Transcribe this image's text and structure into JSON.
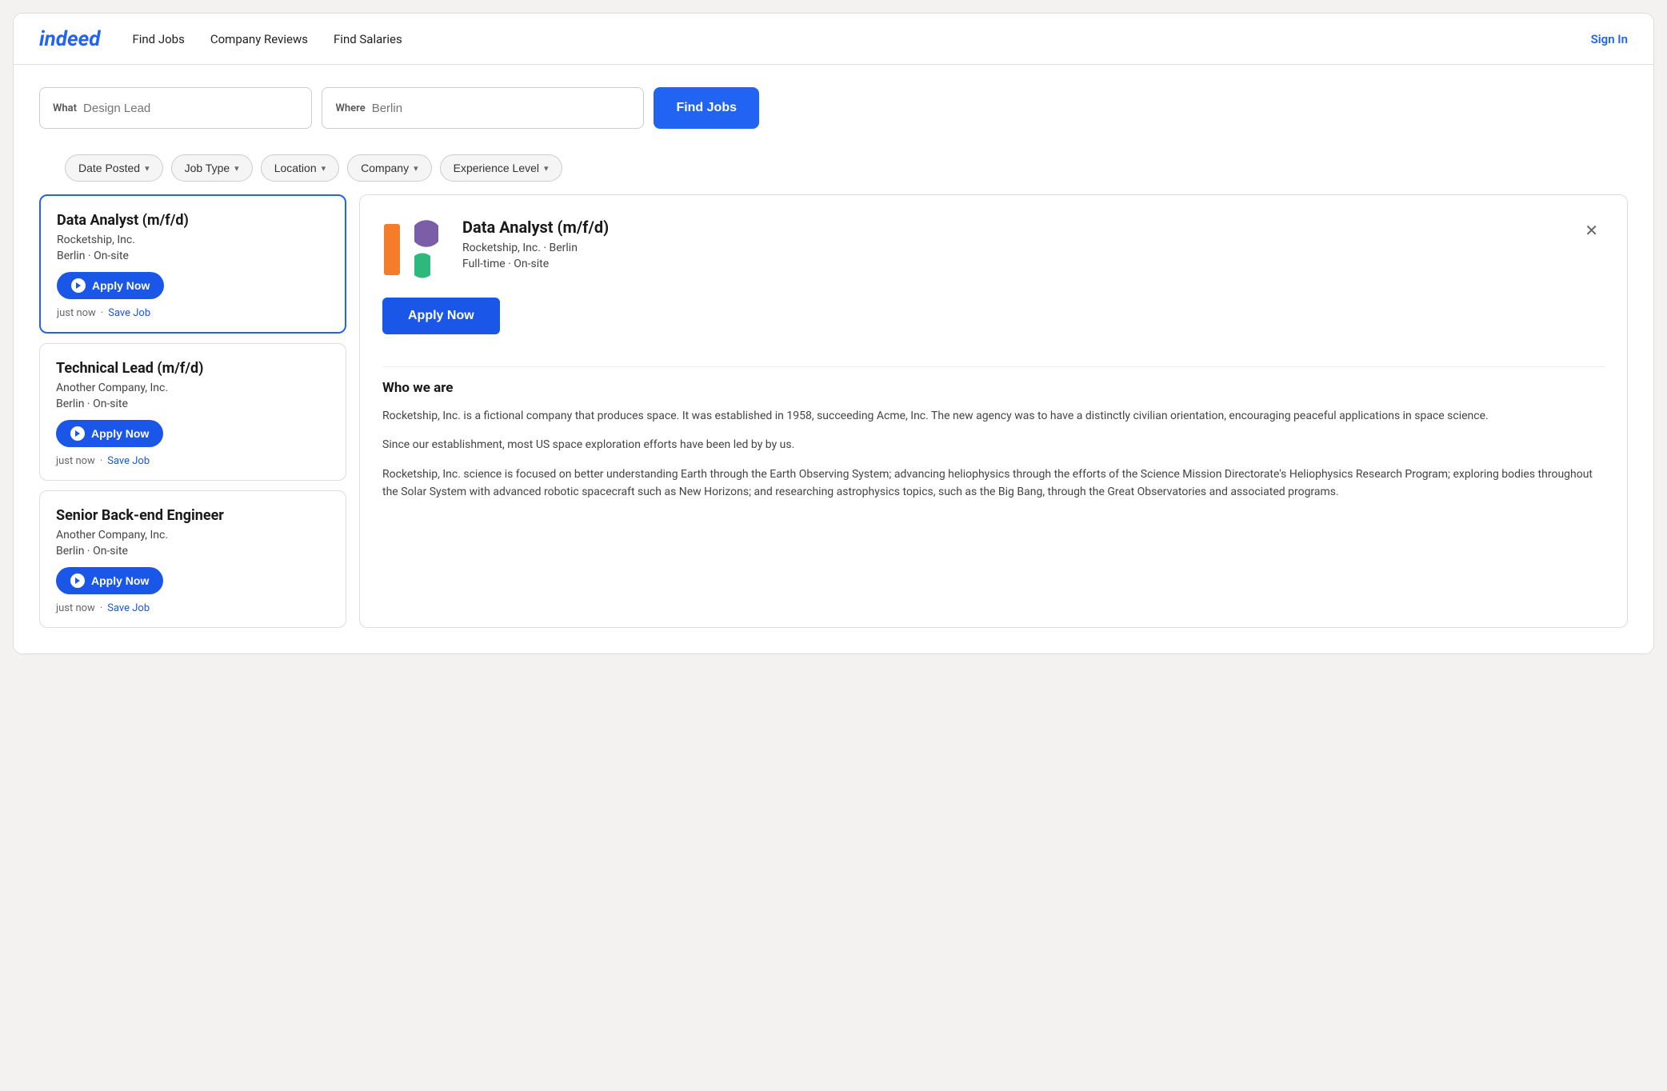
{
  "nav": {
    "logo": "indeed",
    "links": [
      "Find Jobs",
      "Company Reviews",
      "Find Salaries"
    ],
    "sign_in": "Sign In"
  },
  "search": {
    "what_label": "What",
    "what_placeholder": "Design Lead",
    "where_label": "Where",
    "where_placeholder": "Berlin",
    "find_jobs_button": "Find Jobs"
  },
  "filters": [
    {
      "label": "Date Posted",
      "has_chevron": true
    },
    {
      "label": "Job Type",
      "has_chevron": true
    },
    {
      "label": "Location",
      "has_chevron": true
    },
    {
      "label": "Company",
      "has_chevron": true
    },
    {
      "label": "Experience Level",
      "has_chevron": true
    }
  ],
  "jobs": [
    {
      "title": "Data Analyst (m/f/d)",
      "company": "Rocketship, Inc.",
      "location": "Berlin",
      "work_type": "On-site",
      "apply_label": "Apply Now",
      "time_posted": "just now",
      "save_label": "Save Job",
      "selected": true
    },
    {
      "title": "Technical Lead (m/f/d)",
      "company": "Another Company, Inc.",
      "location": "Berlin",
      "work_type": "On-site",
      "apply_label": "Apply Now",
      "time_posted": "just now",
      "save_label": "Save Job",
      "selected": false
    },
    {
      "title": "Senior Back-end Engineer",
      "company": "Another Company, Inc.",
      "location": "Berlin",
      "work_type": "On-site",
      "apply_label": "Apply Now",
      "time_posted": "just now",
      "save_label": "Save Job",
      "selected": false
    }
  ],
  "detail": {
    "title": "Data Analyst (m/f/d)",
    "company": "Rocketship, Inc.",
    "location": "Berlin",
    "employment_type": "Full-time",
    "work_type": "On-site",
    "apply_button": "Apply Now",
    "close_icon": "✕",
    "who_we_are_title": "Who we are",
    "paragraphs": [
      "Rocketship, Inc. is a fictional company that produces space. It was established in 1958, succeeding Acme, Inc. The new agency was to have a distinctly civilian orientation, encouraging peaceful applications in space science.",
      "Since our establishment, most US space exploration efforts have been led by by us.",
      "Rocketship, Inc. science is focused on better understanding Earth through the Earth Observing System; advancing heliophysics through the efforts of the Science Mission Directorate's Heliophysics Research Program; exploring bodies throughout the Solar System with advanced robotic spacecraft such as New Horizons; and researching astrophysics topics, such as the Big Bang, through the Great Observatories and associated programs."
    ]
  }
}
